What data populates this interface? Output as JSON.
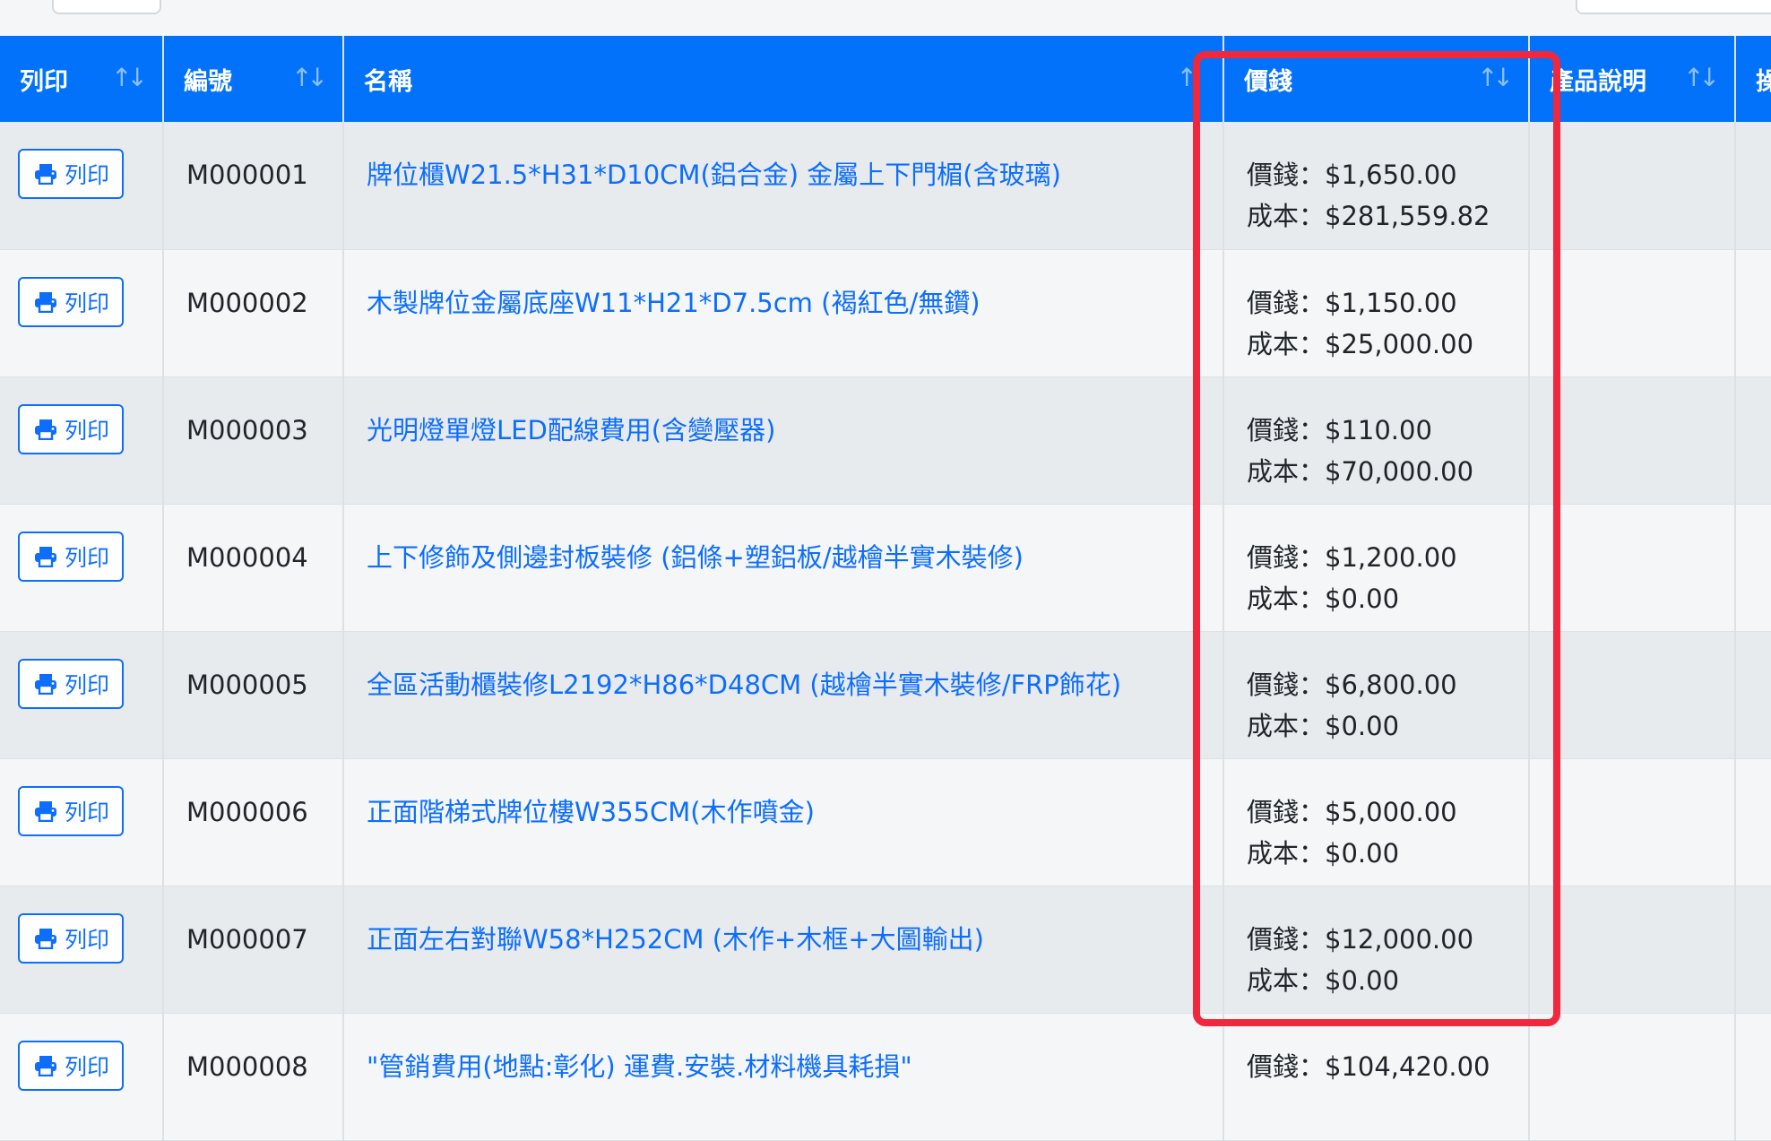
{
  "columns": {
    "print": "列印",
    "code": "編號",
    "name": "名稱",
    "price": "價錢",
    "desc": "產品說明",
    "more": "操"
  },
  "sort_icon": "↑↓",
  "name_sort_icon": "↑",
  "print_label": "列印",
  "price_prefix": "價錢：",
  "cost_prefix": "成本：",
  "rows": [
    {
      "code": "M000001",
      "name": "牌位櫃W21.5*H31*D10CM(鋁合金) 金屬上下門楣(含玻璃)",
      "price": "價錢：$1,650.00",
      "cost": "成本：$281,559.82"
    },
    {
      "code": "M000002",
      "name": "木製牌位金屬底座W11*H21*D7.5cm (褐紅色/無鑽)",
      "price": "價錢：$1,150.00",
      "cost": "成本：$25,000.00"
    },
    {
      "code": "M000003",
      "name": "光明燈單燈LED配線費用(含變壓器)",
      "price": "價錢：$110.00",
      "cost": "成本：$70,000.00"
    },
    {
      "code": "M000004",
      "name": "上下修飾及側邊封板裝修 (鋁條+塑鋁板/越檜半實木裝修)",
      "price": "價錢：$1,200.00",
      "cost": "成本：$0.00"
    },
    {
      "code": "M000005",
      "name": "全區活動櫃裝修L2192*H86*D48CM (越檜半實木裝修/FRP飾花)",
      "price": "價錢：$6,800.00",
      "cost": "成本：$0.00"
    },
    {
      "code": "M000006",
      "name": "正面階梯式牌位樓W355CM(木作噴金)",
      "price": "價錢：$5,000.00",
      "cost": "成本：$0.00"
    },
    {
      "code": "M000007",
      "name": "正面左右對聯W58*H252CM (木作+木框+大圖輸出)",
      "price": "價錢：$12,000.00",
      "cost": "成本：$0.00"
    },
    {
      "code": "M000008",
      "name": "\"管銷費用(地點:彰化) 運費.安裝.材料機具耗損\"",
      "price": "價錢：$104,420.00",
      "cost": ""
    }
  ],
  "colors": {
    "header_bg": "#0272fb",
    "link": "#0d6efd",
    "highlight": "#f0283e"
  },
  "icons": {
    "print": "printer-icon",
    "sort": "sort-arrows-icon"
  }
}
